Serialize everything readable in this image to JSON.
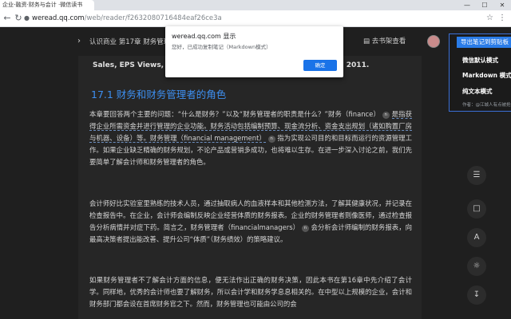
{
  "browser": {
    "tab_title": "企业-融资·财务与会计 ·微信读书",
    "window_controls": [
      "—",
      "☐",
      "✕"
    ],
    "url_host": "weread.qq.com",
    "url_path": "/web/reader/f2632080716484eaf26ce3a",
    "icons": [
      "back-icon",
      "reload-icon",
      "lock-icon",
      "star-icon",
      "menu-icon"
    ]
  },
  "reader": {
    "title": "认识商业 第17章 财务管理",
    "shelf": "去书架查看"
  },
  "dialog": {
    "title": "weread.qq.com 显示",
    "message": "您好，已成功复制笔记（Markdown模式）",
    "ok": "确定"
  },
  "extension": {
    "header": "导出笔记到剪贴板",
    "items": [
      "微信默认模式",
      "Markdown 模式",
      "纯文本模式"
    ],
    "author": "作者：@江城人有点被抢走"
  },
  "content": {
    "top_line": "Sales, EPS Views, Ra",
    "top_line_end": "ry 22, 2011.",
    "section_title": "17.1 财务和财务管理者的角色",
    "p1": [
      "本章要回答两个主要的问题：“什么是财务？”以及“财务管理者的职责是什么？”财务",
      "（finance）",
      "是指获得企业所需资金并进行管理的企业功能。财务活动包括编制预算、现金流分",
      "析、资金支出规划（诸如购置厂房与机器、设备）等。财务管理（financial management）",
      "指为实现公司目的和目标而运行的资源管理工作。如果企业缺乏精确的财务规划，不论产品",
      "或营销多成功，也将难以生存。在进一步深入讨论之前，我们先要简单了解会计师和财务管理者",
      "的角色。"
    ],
    "p2": [
      "会计师好比实验室里熟练的技术人员，通过抽取病人的血液样本和其他检测方法，了解其健康状",
      "况，并记录在检查报告中。在企业，会计师会编制反映企业经营体质的财务报表。企业的财务管",
      "理者则像医师，通过检查报告分析病情并对症下药。简言之，财务管理者（financial",
      "managers）",
      "会分析会计师编制的财务报表，向最高决策者提出能改善、提升公司“体质”",
      "（财务绩效）的策略建议。"
    ],
    "p3": [
      "如果财务管理者不了解会计方面的信息，便无法作出正确的财务决策，因此本书在第16章中先",
      "介绍了会计学。同样地，优秀的会计师也要了解财务，所以会计学和财务学息息相关的。在中型",
      "以上规模的企业，会计和财务部门都会设在首席财务官之下。然而，财务管理也可能由公司的会"
    ]
  },
  "side_tools": [
    "catalog-icon",
    "note-icon",
    "font-icon",
    "theme-icon",
    "download-icon"
  ]
}
